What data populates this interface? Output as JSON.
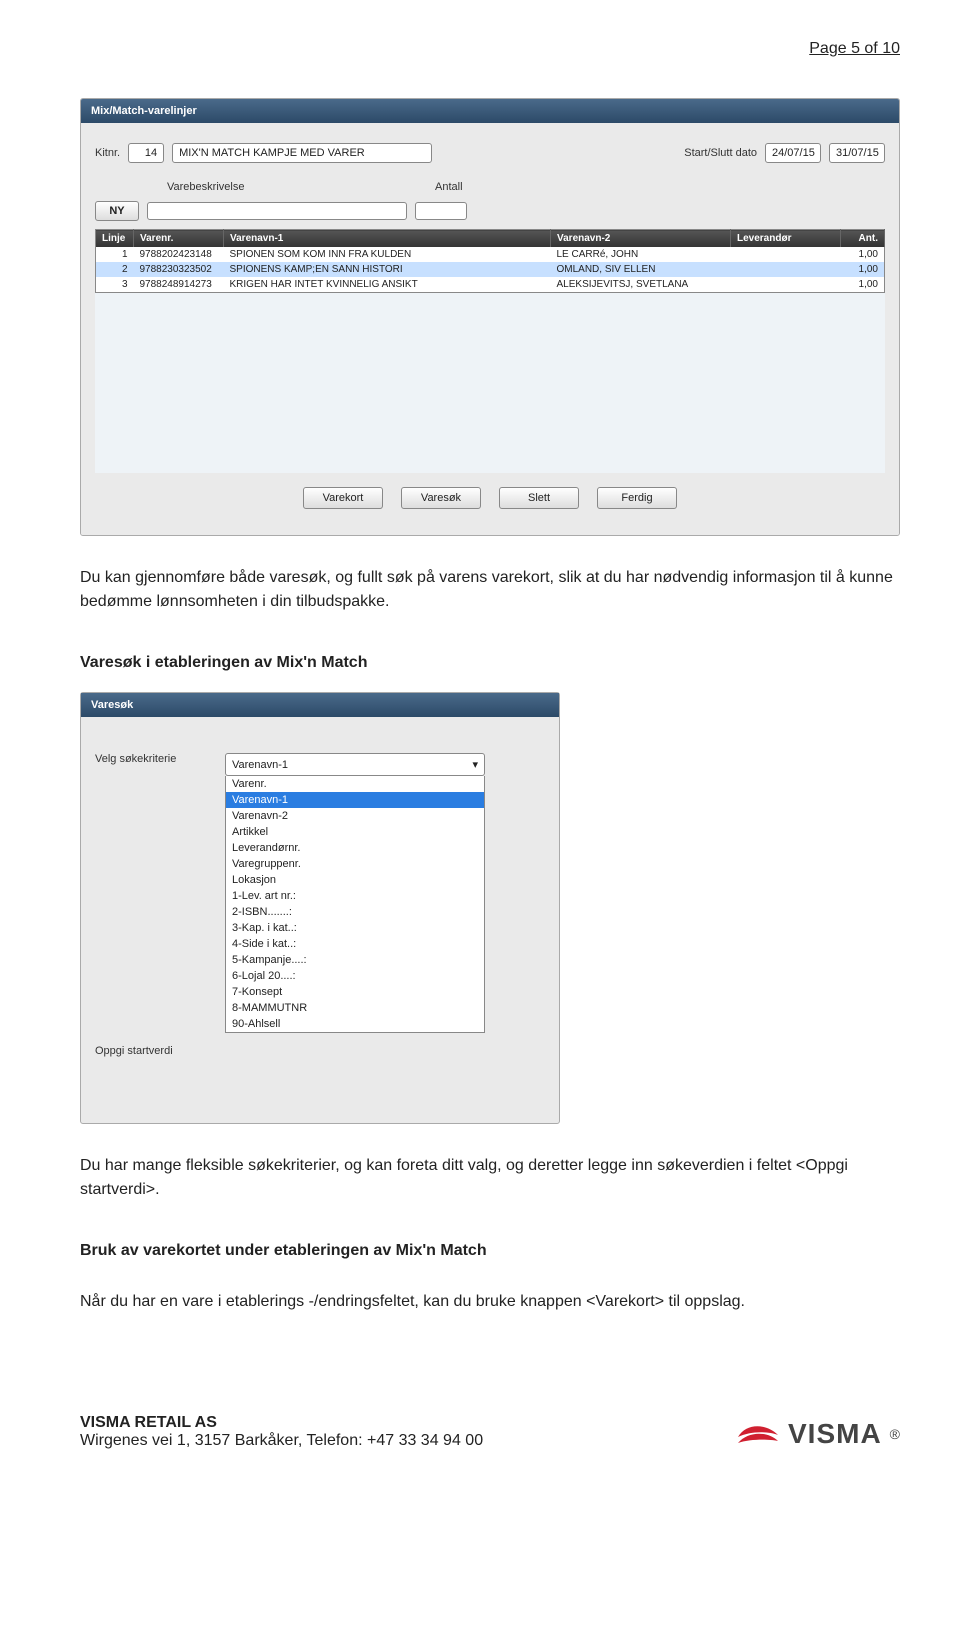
{
  "page_number": "Page 5 of 10",
  "intro_paragraph": "Du kan gjennomføre både varesøk, og fullt søk på varens varekort, slik at du har nødvendig informasjon til å kunne bedømme lønnsomheten i din tilbudspakke.",
  "section1_heading": "Varesøk i etableringen av Mix'n Match",
  "main_panel": {
    "title": "Mix/Match-varelinjer",
    "labels": {
      "kitnr": "Kitnr.",
      "startslutt": "Start/Slutt dato",
      "varebeskrivelse": "Varebeskrivelse",
      "antall": "Antall"
    },
    "kit_no": "14",
    "kit_name": "MIX'N MATCH KAMPJE MED VARER",
    "date_start": "24/07/15",
    "date_end": "31/07/15",
    "ny_btn": "NY",
    "headers": [
      "Linje",
      "Varenr.",
      "Varenavn-1",
      "Varenavn-2",
      "Leverandør",
      "Ant."
    ],
    "rows": [
      {
        "linje": "1",
        "varenr": "9788202423148",
        "navn1": "SPIONEN SOM KOM INN FRA KULDEN",
        "navn2": "LE CARRé, JOHN",
        "lev": "",
        "ant": "1,00"
      },
      {
        "linje": "2",
        "varenr": "9788230323502",
        "navn1": "SPIONENS KAMP;EN SANN HISTORI",
        "navn2": "OMLAND, SIV ELLEN",
        "lev": "",
        "ant": "1,00"
      },
      {
        "linje": "3",
        "varenr": "9788248914273",
        "navn1": "KRIGEN HAR INTET KVINNELIG ANSIKT",
        "navn2": "ALEKSIJEVITSJ, SVETLANA",
        "lev": "",
        "ant": "1,00"
      }
    ],
    "buttons": {
      "varekort": "Varekort",
      "varesok": "Varesøk",
      "slett": "Slett",
      "ferdig": "Ferdig"
    }
  },
  "search_panel": {
    "title": "Varesøk",
    "label_kriterie": "Velg søkekriterie",
    "label_start": "Oppgi startverdi",
    "selected_value": "Varenavn-1",
    "options": [
      {
        "text": "Varenr.",
        "hl": false
      },
      {
        "text": "Varenavn-1",
        "hl": true
      },
      {
        "text": "Varenavn-2",
        "hl": false
      },
      {
        "text": "Artikkel",
        "hl": false
      },
      {
        "text": "Leverandørnr.",
        "hl": false
      },
      {
        "text": "Varegruppenr.",
        "hl": false
      },
      {
        "text": "Lokasjon",
        "hl": false
      },
      {
        "text": "1-Lev. art nr.:",
        "hl": false
      },
      {
        "text": "2-ISBN.......:",
        "hl": false
      },
      {
        "text": "3-Kap. i kat..:",
        "hl": false
      },
      {
        "text": "4-Side i kat..:",
        "hl": false
      },
      {
        "text": "5-Kampanje....:",
        "hl": false
      },
      {
        "text": "6-Lojal 20....:",
        "hl": false
      },
      {
        "text": "7-Konsept",
        "hl": false
      },
      {
        "text": "8-MAMMUTNR",
        "hl": false
      },
      {
        "text": "90-Ahlsell",
        "hl": false
      }
    ]
  },
  "para2": "Du har mange fleksible søkekriterier, og kan foreta ditt valg, og deretter legge inn søkeverdien i feltet <Oppgi startverdi>.",
  "section2_heading": "Bruk av varekortet under etableringen av Mix'n Match",
  "para3": "Når du har en vare i etablerings -/endringsfeltet, kan du bruke knappen <Varekort> til oppslag.",
  "footer": {
    "company": "VISMA RETAIL AS",
    "address": "Wirgenes vei 1, 3157 Barkåker, Telefon: +47 33 34 94 00",
    "logo": "VISMA"
  }
}
